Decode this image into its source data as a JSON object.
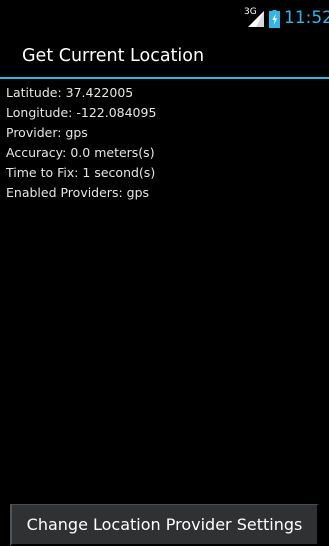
{
  "status_bar": {
    "network_type": "3G",
    "signal_icon": "cell-signal-icon",
    "battery_icon": "battery-charging-icon",
    "time": "11:52",
    "time_color": "#33b5e5"
  },
  "action_bar": {
    "title": "Get Current Location",
    "divider_color": "#33b5e5"
  },
  "location_info": {
    "latitude": "Latitude: 37.422005",
    "longitude": "Longitude: -122.084095",
    "provider": "Provider: gps",
    "accuracy": "Accuracy: 0.0 meters(s)",
    "time_to_fix": "Time to Fix: 1 second(s)",
    "enabled_providers": "Enabled Providers: gps"
  },
  "bottom_button": {
    "label": "Change Location Provider Settings"
  }
}
